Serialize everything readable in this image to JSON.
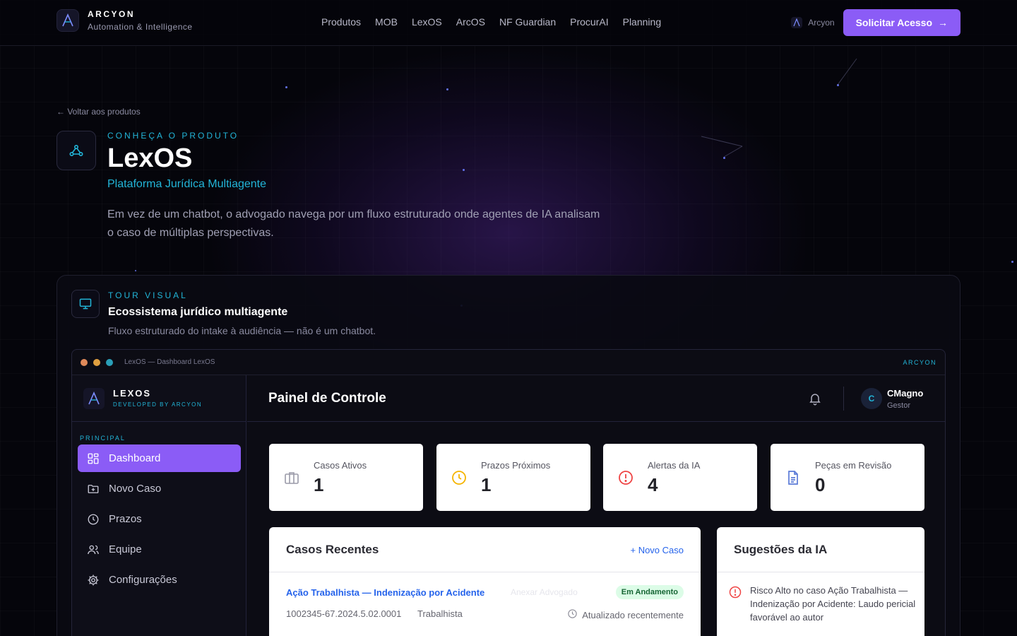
{
  "nav": {
    "brand_name": "ARCYON",
    "brand_tagline": "Automation & Intelligence",
    "links": [
      "Produtos",
      "MOB",
      "LexOS",
      "ArcOS",
      "NF Guardian",
      "ProcurAI",
      "Planning"
    ],
    "account_label": "Arcyon",
    "cta_label": "Solicitar Acesso",
    "cta_arrow": "→"
  },
  "hero": {
    "back_link": "← Voltar aos produtos",
    "eyebrow": "CONHEÇA O PRODUTO",
    "title": "LexOS",
    "subtitle": "Plataforma Jurídica Multiagente",
    "description": "Em vez de um chatbot, o advogado navega por um fluxo estruturado onde agentes de IA analisam o caso de múltiplas perspectivas."
  },
  "tour": {
    "eyebrow": "TOUR VISUAL",
    "title": "Ecossistema jurídico multiagente",
    "description": "Fluxo estruturado do intake à audiência — não é um chatbot."
  },
  "app": {
    "window_title": "LexOS — Dashboard LexOS",
    "window_brand": "ARCYON",
    "sidebar": {
      "name": "LEXOS",
      "developer": "DEVELOPED BY ARCYON",
      "section": "PRINCIPAL",
      "items": [
        {
          "label": "Dashboard",
          "icon": "grid-icon"
        },
        {
          "label": "Novo Caso",
          "icon": "folder-plus-icon"
        },
        {
          "label": "Prazos",
          "icon": "clock-icon"
        },
        {
          "label": "Equipe",
          "icon": "users-icon"
        },
        {
          "label": "Configurações",
          "icon": "gear-icon"
        }
      ]
    },
    "header": {
      "title": "Painel de Controle",
      "user_initial": "C",
      "user_name": "CMagno",
      "user_role": "Gestor"
    },
    "stats": [
      {
        "label": "Casos Ativos",
        "value": "1",
        "icon": "briefcase-icon"
      },
      {
        "label": "Prazos Próximos",
        "value": "1",
        "icon": "clock-icon"
      },
      {
        "label": "Alertas da IA",
        "value": "4",
        "icon": "alert-icon"
      },
      {
        "label": "Peças em Revisão",
        "value": "0",
        "icon": "document-icon"
      }
    ],
    "recent_cases": {
      "title": "Casos Recentes",
      "action": "+ Novo Caso",
      "case_title": "Ação Trabalhista — Indenização por Acidente",
      "case_ghost": "Anexar Advogado",
      "status": "Em Andamento",
      "number": "1002345-67.2024.5.02.0001",
      "area": "Trabalhista",
      "updated": "Atualizado recentemente"
    },
    "suggestions": {
      "title": "Sugestões da IA",
      "text": "Risco Alto no caso Ação Trabalhista — Indenização por Acidente: Laudo pericial favorável ao autor"
    }
  },
  "colors": {
    "accent_purple": "#8b5cf6",
    "accent_cyan": "#22b5d8",
    "link_blue": "#2563eb",
    "alert_red": "#ef4444",
    "warning_amber": "#f5b400",
    "success_bg": "#dcfce7"
  }
}
